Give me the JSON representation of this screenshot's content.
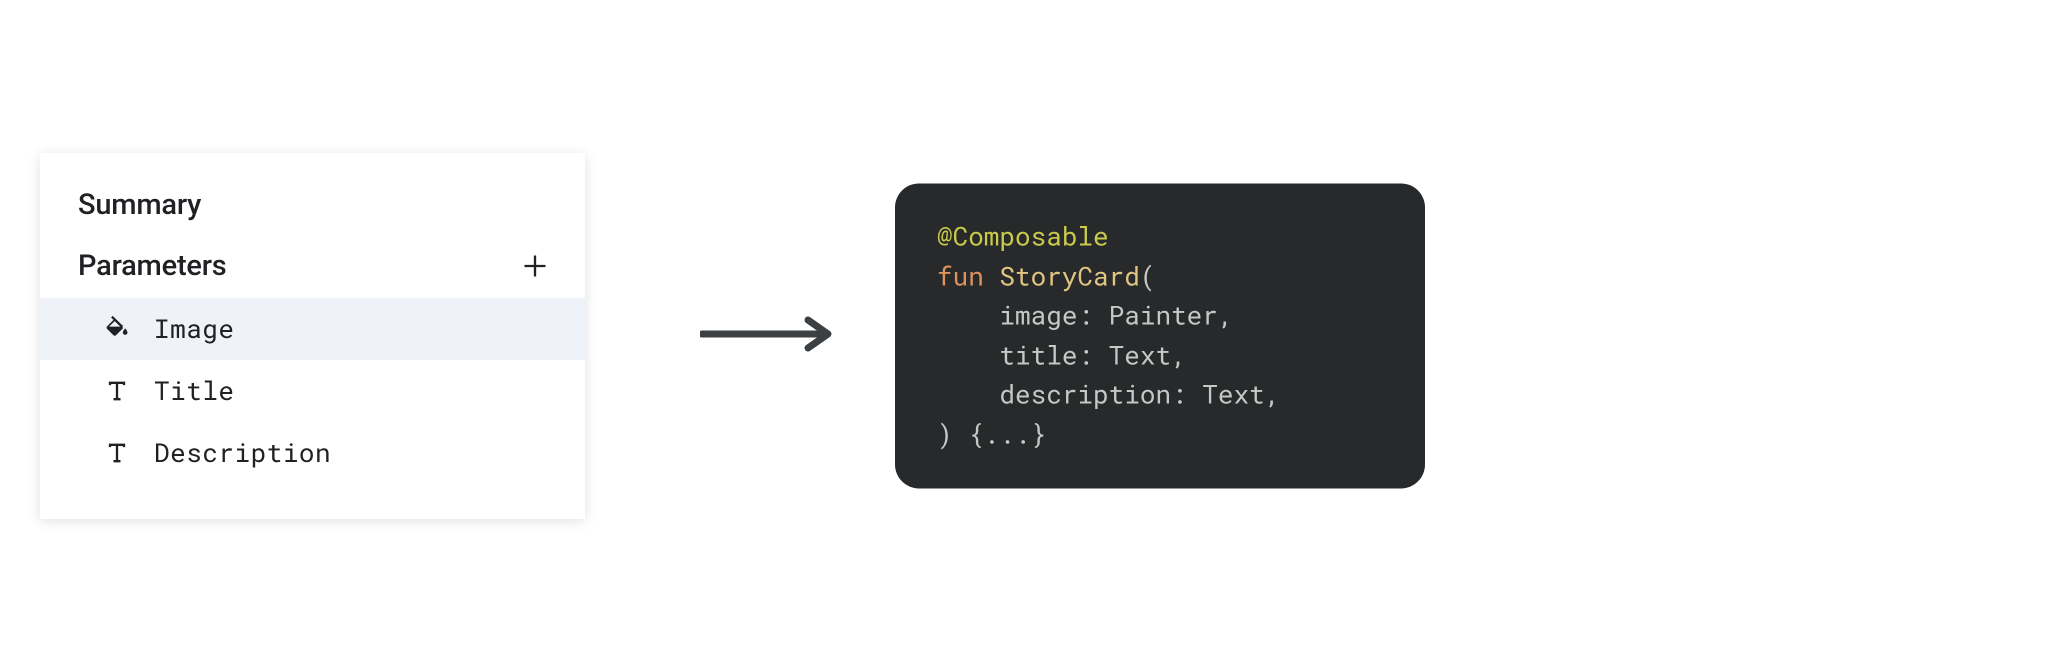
{
  "panel": {
    "title": "Summary",
    "parametersLabel": "Parameters",
    "items": [
      {
        "name": "Image",
        "icon": "fill",
        "selected": true
      },
      {
        "name": "Title",
        "icon": "text",
        "selected": false
      },
      {
        "name": "Description",
        "icon": "text",
        "selected": false
      }
    ]
  },
  "code": {
    "annotation": "@Composable",
    "keyword_fun": "fun",
    "function_name": "StoryCard",
    "open_paren": "(",
    "params": [
      {
        "name": "image",
        "type": "Painter"
      },
      {
        "name": "title",
        "type": "Text"
      },
      {
        "name": "description",
        "type": "Text"
      }
    ],
    "close": ") {...}"
  }
}
